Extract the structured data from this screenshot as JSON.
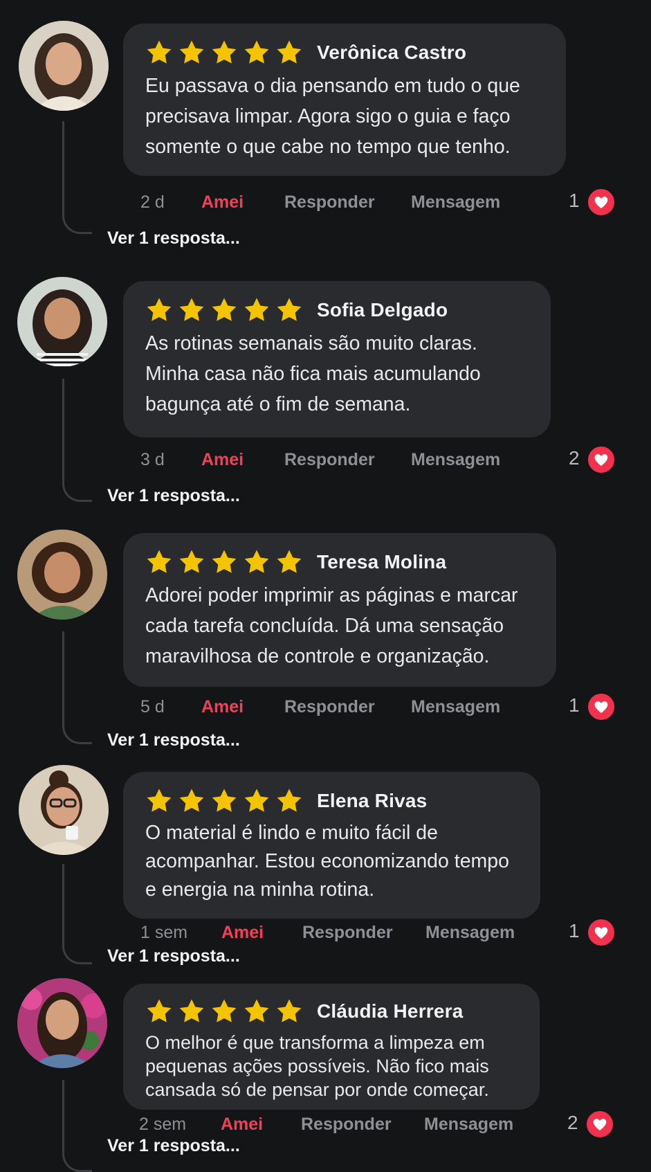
{
  "colors": {
    "background": "#141517",
    "bubble": "#2a2b2e",
    "star": "#f5c400",
    "love_accent": "#f0415a",
    "heart_badge": "#f0324f"
  },
  "icons": {
    "rating": "star-icon",
    "reaction": "heart-icon"
  },
  "comments": [
    {
      "author": "Verônica Castro",
      "rating": 5,
      "text": "Eu passava o dia pensando em tudo o que\nprecisava limpar. Agora sigo o guia e faço\nsomente o que cabe no tempo que tenho.",
      "time": "2 d",
      "love_label": "Amei",
      "reply_label": "Responder",
      "message_label": "Mensagem",
      "reaction_count": "1",
      "see_replies": "Ver 1 resposta..."
    },
    {
      "author": "Sofia Delgado",
      "rating": 5,
      "text": "As rotinas semanais são muito claras.\nMinha casa não fica mais acumulando\nbagunça até o fim de semana.",
      "time": "3 d",
      "love_label": "Amei",
      "reply_label": "Responder",
      "message_label": "Mensagem",
      "reaction_count": "2",
      "see_replies": "Ver 1 resposta..."
    },
    {
      "author": "Teresa Molina",
      "rating": 5,
      "text": "Adorei poder imprimir as páginas e marcar\ncada tarefa concluída. Dá uma sensação\nmaravilhosa de controle e organização.",
      "time": "5 d",
      "love_label": "Amei",
      "reply_label": "Responder",
      "message_label": "Mensagem",
      "reaction_count": "1",
      "see_replies": "Ver 1 resposta..."
    },
    {
      "author": "Elena Rivas",
      "rating": 5,
      "text": "O material é lindo e muito fácil de\nacompanhar. Estou economizando tempo\ne energia na minha rotina.",
      "time": "1 sem",
      "love_label": "Amei",
      "reply_label": "Responder",
      "message_label": "Mensagem",
      "reaction_count": "1",
      "see_replies": "Ver 1 resposta..."
    },
    {
      "author": "Cláudia Herrera",
      "rating": 5,
      "text": "O melhor é que transforma a limpeza em\npequenas ações possíveis. Não fico mais\ncansada só de pensar por onde começar.",
      "time": "2 sem",
      "love_label": "Amei",
      "reply_label": "Responder",
      "message_label": "Mensagem",
      "reaction_count": "2",
      "see_replies": "Ver 1 resposta..."
    }
  ]
}
